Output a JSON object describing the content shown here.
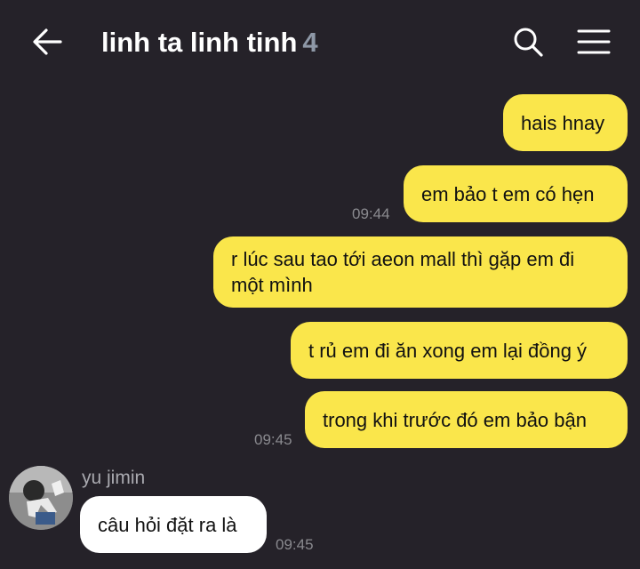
{
  "header": {
    "title": "linh ta linh tinh",
    "member_count": "4",
    "icons": [
      "back-arrow-icon",
      "search-icon",
      "menu-icon"
    ]
  },
  "messages": [
    {
      "from": "me",
      "text": "hais hnay"
    },
    {
      "from": "me",
      "text": "em bảo t em có hẹn",
      "time": "09:44"
    },
    {
      "from": "me",
      "text": "r lúc sau tao tới aeon mall thì gặp em đi một mình"
    },
    {
      "from": "me",
      "text": "t rủ em đi ăn xong em lại đồng ý"
    },
    {
      "from": "me",
      "text": "trong khi trước đó em bảo bận",
      "time": "09:45"
    },
    {
      "from": "them",
      "sender": "yu jimin",
      "text": "câu hỏi đặt ra là",
      "time": "09:45"
    }
  ],
  "colors": {
    "background": "#252229",
    "my_bubble": "#fae64b",
    "their_bubble": "#ffffff",
    "member_count": "#8e98a7"
  }
}
